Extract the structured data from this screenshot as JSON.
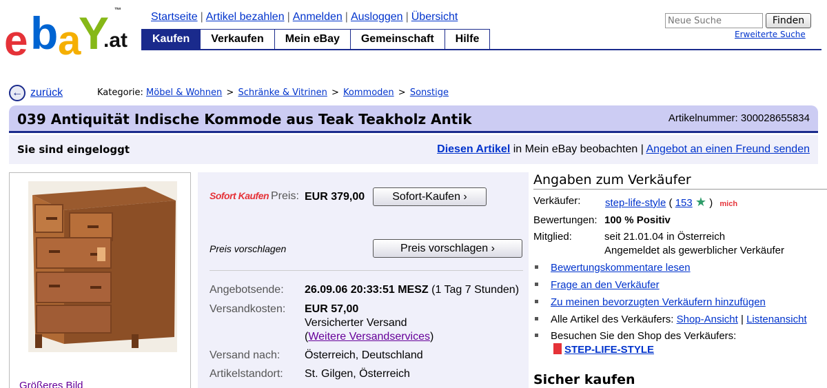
{
  "logo": {
    "letters": [
      "e",
      "b",
      "a",
      "Y"
    ],
    "suffix": ".at",
    "tm": "™",
    "colors": [
      "#e53238",
      "#0064d2",
      "#f5af02",
      "#86b817"
    ]
  },
  "toplinks": [
    "Startseite",
    "Artikel bezahlen",
    "Anmelden",
    "Ausloggen",
    "Übersicht"
  ],
  "nav": {
    "tabs": [
      "Kaufen",
      "Verkaufen",
      "Mein eBay",
      "Gemeinschaft",
      "Hilfe"
    ],
    "active": "Kaufen",
    "accent": "#1a2a8c"
  },
  "search": {
    "placeholder": "Neue Suche",
    "button": "Finden",
    "advanced": "Erweiterte Suche"
  },
  "back": {
    "label": "zurück",
    "icon": "back-arrow-icon"
  },
  "category": {
    "label": "Kategorie:",
    "path": [
      "Möbel & Wohnen",
      "Schränke & Vitrinen",
      "Kommoden",
      "Sonstige"
    ]
  },
  "item": {
    "title": "039 Antiquität Indische Kommode aus Teak Teakholz Antik",
    "number_label": "Artikelnummer: 300028655834"
  },
  "login": {
    "status": "Sie sind eingeloggt",
    "watch_link": "Diesen Artikel",
    "watch_text": "in Mein eBay beobachten",
    "sep": "|",
    "send_link": "Angebot an einen Freund senden"
  },
  "image": {
    "bigger_label": "Größeres Bild"
  },
  "price": {
    "sofort_logo": "Sofort Kaufen",
    "preis_label": "Preis:",
    "value": "EUR 379,00",
    "buy_button": "Sofort-Kaufen ›",
    "offer_label": "Preis vorschlagen",
    "offer_button": "Preis vorschlagen ›"
  },
  "details": {
    "end_label": "Angebotsende:",
    "end_value": "26.09.06 20:33:51 MESZ",
    "end_remaining": "(1 Tag 7 Stunden)",
    "shipping_label": "Versandkosten:",
    "shipping_value": "EUR 57,00",
    "shipping_type": "Versicherter Versand",
    "shipping_more_open": "(",
    "shipping_more_link": "Weitere Versandservices",
    "shipping_more_close": ")",
    "ship_to_label": "Versand nach:",
    "ship_to_value": "Österreich, Deutschland",
    "location_label": "Artikelstandort:",
    "location_value": "St. Gilgen, Österreich"
  },
  "seller": {
    "heading": "Angaben zum Verkäufer",
    "seller_label": "Verkäufer:",
    "seller_name": "step-life-style",
    "open_paren": "(",
    "score": "153",
    "close_paren": ")",
    "me_icon": "mich",
    "rating_label": "Bewertungen:",
    "rating_value": "100 % Positiv",
    "member_label": "Mitglied:",
    "member_since": "seit 21.01.04 in Österreich",
    "member_type": "Angemeldet als gewerblicher Verkäufer",
    "link_feedback": "Bewertungskommentare lesen",
    "link_question": "Frage an den Verkäufer",
    "link_favorite": "Zu meinen bevorzugten Verkäufern hinzufügen",
    "all_items_text": "Alle Artikel des Verkäufers:",
    "shop_view": "Shop-Ansicht",
    "pipe": "|",
    "list_view": "Listenansicht",
    "visit_shop_text": "Besuchen Sie den Shop des Verkäufers:",
    "shop_name": "STEP-LIFE-STYLE"
  },
  "secure": {
    "heading": "Sicher kaufen"
  }
}
